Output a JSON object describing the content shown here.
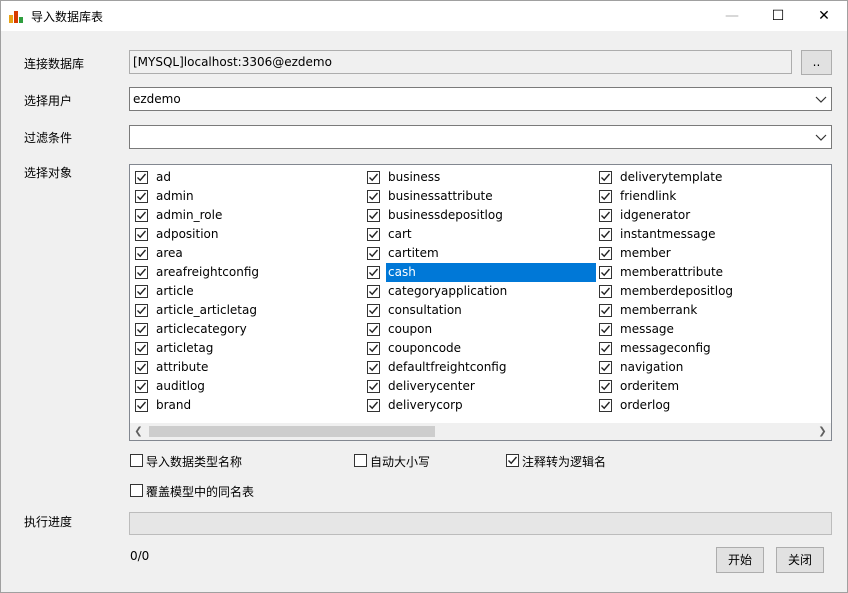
{
  "window": {
    "title": "导入数据库表",
    "min_glyph": "—",
    "max_glyph": "☐",
    "close_glyph": "✕"
  },
  "form": {
    "connection_label": "连接数据库",
    "connection_value": "[MYSQL]localhost:3306@ezdemo",
    "browse_label": "..",
    "user_label": "选择用户",
    "user_value": "ezdemo",
    "filter_label": "过滤条件",
    "filter_value": "",
    "objects_label": "选择对象",
    "progress_label": "执行进度",
    "progress_fraction": 0
  },
  "objects": {
    "columns": [
      [
        {
          "name": "ad",
          "checked": true
        },
        {
          "name": "admin",
          "checked": true
        },
        {
          "name": "admin_role",
          "checked": true
        },
        {
          "name": "adposition",
          "checked": true
        },
        {
          "name": "area",
          "checked": true
        },
        {
          "name": "areafreightconfig",
          "checked": true
        },
        {
          "name": "article",
          "checked": true
        },
        {
          "name": "article_articletag",
          "checked": true
        },
        {
          "name": "articlecategory",
          "checked": true
        },
        {
          "name": "articletag",
          "checked": true
        },
        {
          "name": "attribute",
          "checked": true
        },
        {
          "name": "auditlog",
          "checked": true
        },
        {
          "name": "brand",
          "checked": true
        }
      ],
      [
        {
          "name": "business",
          "checked": true
        },
        {
          "name": "businessattribute",
          "checked": true
        },
        {
          "name": "businessdepositlog",
          "checked": true
        },
        {
          "name": "cart",
          "checked": true
        },
        {
          "name": "cartitem",
          "checked": true
        },
        {
          "name": "cash",
          "checked": true,
          "selected": true
        },
        {
          "name": "categoryapplication",
          "checked": true
        },
        {
          "name": "consultation",
          "checked": true
        },
        {
          "name": "coupon",
          "checked": true
        },
        {
          "name": "couponcode",
          "checked": true
        },
        {
          "name": "defaultfreightconfig",
          "checked": true
        },
        {
          "name": "deliverycenter",
          "checked": true
        },
        {
          "name": "deliverycorp",
          "checked": true
        }
      ],
      [
        {
          "name": "deliverytemplate",
          "checked": true
        },
        {
          "name": "friendlink",
          "checked": true
        },
        {
          "name": "idgenerator",
          "checked": true
        },
        {
          "name": "instantmessage",
          "checked": true
        },
        {
          "name": "member",
          "checked": true
        },
        {
          "name": "memberattribute",
          "checked": true
        },
        {
          "name": "memberdepositlog",
          "checked": true
        },
        {
          "name": "memberrank",
          "checked": true
        },
        {
          "name": "message",
          "checked": true
        },
        {
          "name": "messageconfig",
          "checked": true
        },
        {
          "name": "navigation",
          "checked": true
        },
        {
          "name": "orderitem",
          "checked": true
        },
        {
          "name": "orderlog",
          "checked": true
        }
      ]
    ]
  },
  "options": {
    "import_type_name": {
      "label": "导入数据类型名称",
      "checked": false
    },
    "auto_case": {
      "label": "自动大小写",
      "checked": false
    },
    "comment_to_logical": {
      "label": "注释转为逻辑名",
      "checked": true
    },
    "overwrite_same_name": {
      "label": "覆盖模型中的同名表",
      "checked": false
    }
  },
  "footer": {
    "counter": "0/0",
    "start_label": "开始",
    "close_label": "关闭"
  }
}
